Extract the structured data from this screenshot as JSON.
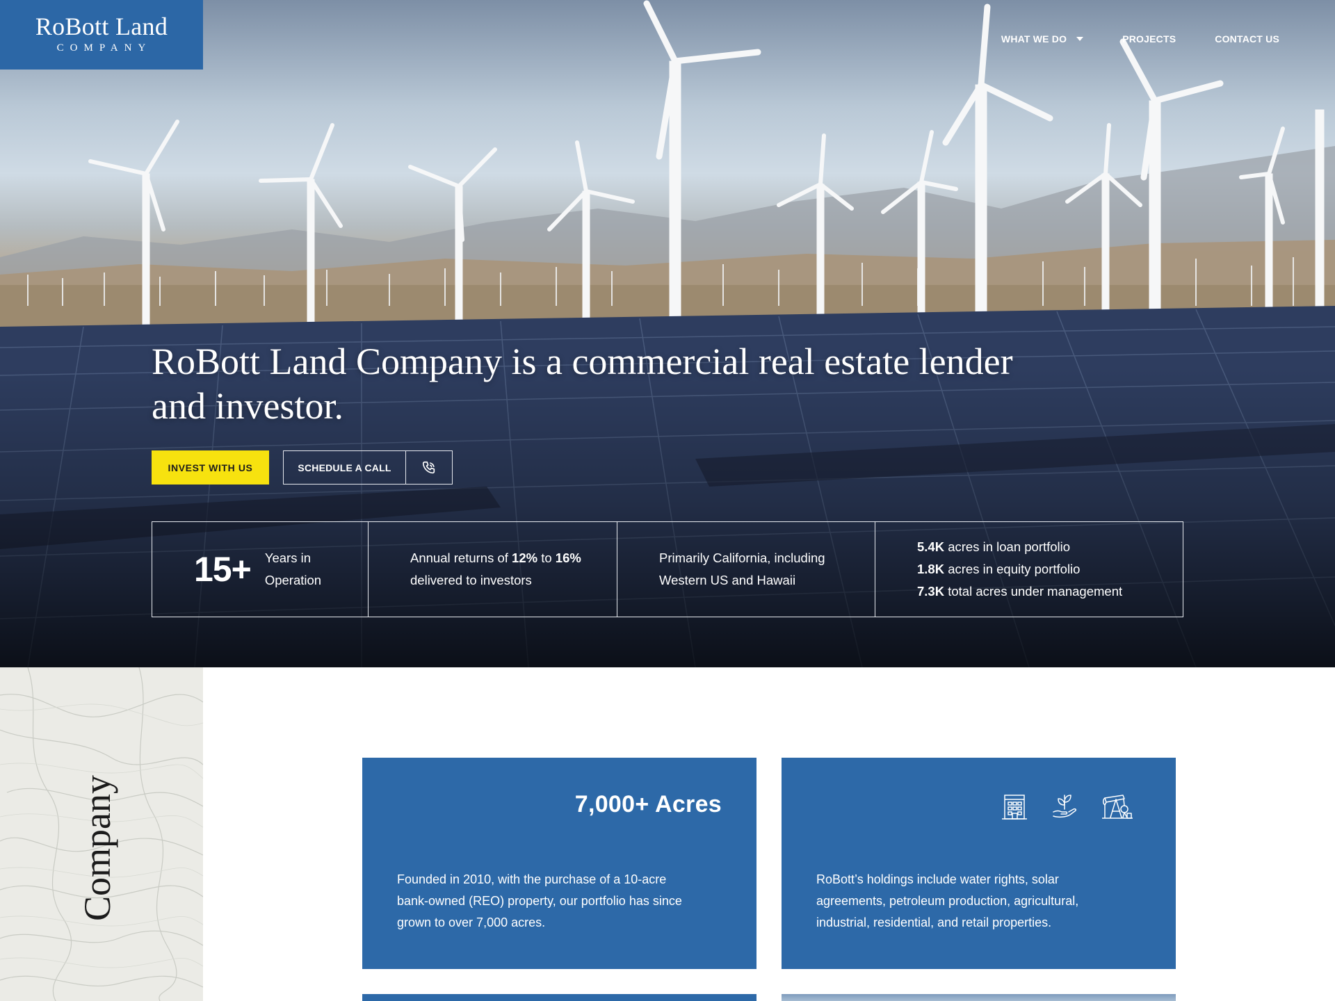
{
  "logo": {
    "name": "RoBott Land",
    "sub": "COMPANY"
  },
  "nav": {
    "items": [
      {
        "label": "WHAT WE DO",
        "dropdown": true
      },
      {
        "label": "PROJECTS"
      },
      {
        "label": "CONTACT US"
      }
    ]
  },
  "hero": {
    "headline": "RoBott Land Company is a commercial real estate lender and investor.",
    "invest_label": "INVEST WITH US",
    "call_label": "SCHEDULE A CALL",
    "call_icon": "phone-icon",
    "stats": {
      "years": {
        "number": "15+",
        "text_1": "Years in",
        "text_2": "Operation"
      },
      "returns": {
        "prefix": "Annual returns of",
        "low": "12%",
        "mid": "to",
        "high": "16%",
        "line_2": "delivered to investors"
      },
      "region": {
        "line_1": "Primarily California, including",
        "line_2": "Western US and Hawaii"
      },
      "acres": [
        {
          "value": "5.4K",
          "text": "acres in loan portfolio"
        },
        {
          "value": "1.8K",
          "text": "acres in equity portfolio"
        },
        {
          "value": "7.3K",
          "text": "total acres under management"
        }
      ]
    }
  },
  "section": {
    "title": "Company",
    "card_left": {
      "title": "7,000+ Acres",
      "text": "Founded in 2010, with the purchase of a 10-acre bank-owned (REO) property, our portfolio has since grown to over 7,000 acres."
    },
    "card_right": {
      "icons": [
        "building-icon",
        "plant-in-hand-icon",
        "oil-pump-icon"
      ],
      "text": "RoBott’s holdings include water rights, solar agreements, petroleum production, agricultural, industrial, residential, and retail properties."
    }
  },
  "colors": {
    "brand_blue": "#2c67a6",
    "accent_yellow": "#f7e20f"
  }
}
